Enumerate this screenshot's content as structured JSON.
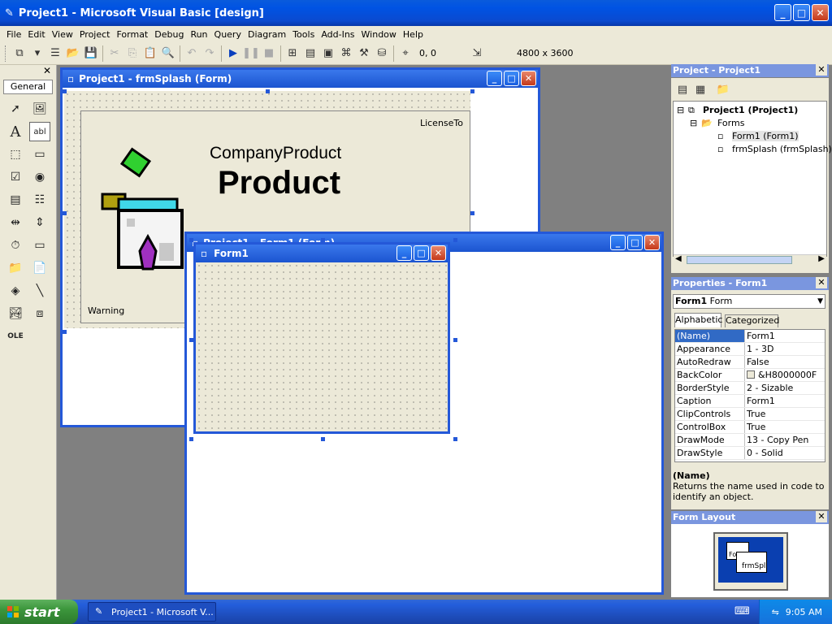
{
  "app": {
    "title": "Project1 - Microsoft Visual Basic [design]"
  },
  "menu": [
    "File",
    "Edit",
    "View",
    "Project",
    "Format",
    "Debug",
    "Run",
    "Query",
    "Diagram",
    "Tools",
    "Add-Ins",
    "Window",
    "Help"
  ],
  "toolbar": {
    "position": "0, 0",
    "size": "4800 x 3600"
  },
  "toolbox": {
    "tab": "General"
  },
  "splash_window": {
    "title": "Project1 - frmSplash (Form)",
    "license": "LicenseTo",
    "company": "CompanyProduct",
    "product": "Product",
    "warning": "Warning"
  },
  "form1_window": {
    "title": "Project1 - Form1 (Form)",
    "form_caption": "Form1"
  },
  "project_explorer": {
    "title": "Project - Project1",
    "root": "Project1 (Project1)",
    "forms_folder": "Forms",
    "items": [
      "Form1 (Form1)",
      "frmSplash (frmSplash)"
    ]
  },
  "properties": {
    "title": "Properties - Form1",
    "object": "Form1",
    "object_type": "Form",
    "tabs": [
      "Alphabetic",
      "Categorized"
    ],
    "rows": [
      {
        "k": "(Name)",
        "v": "Form1"
      },
      {
        "k": "Appearance",
        "v": "1 - 3D"
      },
      {
        "k": "AutoRedraw",
        "v": "False"
      },
      {
        "k": "BackColor",
        "v": "&H8000000F"
      },
      {
        "k": "BorderStyle",
        "v": "2 - Sizable"
      },
      {
        "k": "Caption",
        "v": "Form1"
      },
      {
        "k": "ClipControls",
        "v": "True"
      },
      {
        "k": "ControlBox",
        "v": "True"
      },
      {
        "k": "DrawMode",
        "v": "13 - Copy Pen"
      },
      {
        "k": "DrawStyle",
        "v": "0 - Solid"
      }
    ],
    "desc_title": "(Name)",
    "desc_text": "Returns the name used in code to identify an object."
  },
  "form_layout": {
    "title": "Form Layout",
    "thumb_labels": [
      "Fo",
      "frmSpl"
    ]
  },
  "taskbar": {
    "start": "start",
    "task": "Project1 - Microsoft V...",
    "clock": "9:05 AM"
  }
}
